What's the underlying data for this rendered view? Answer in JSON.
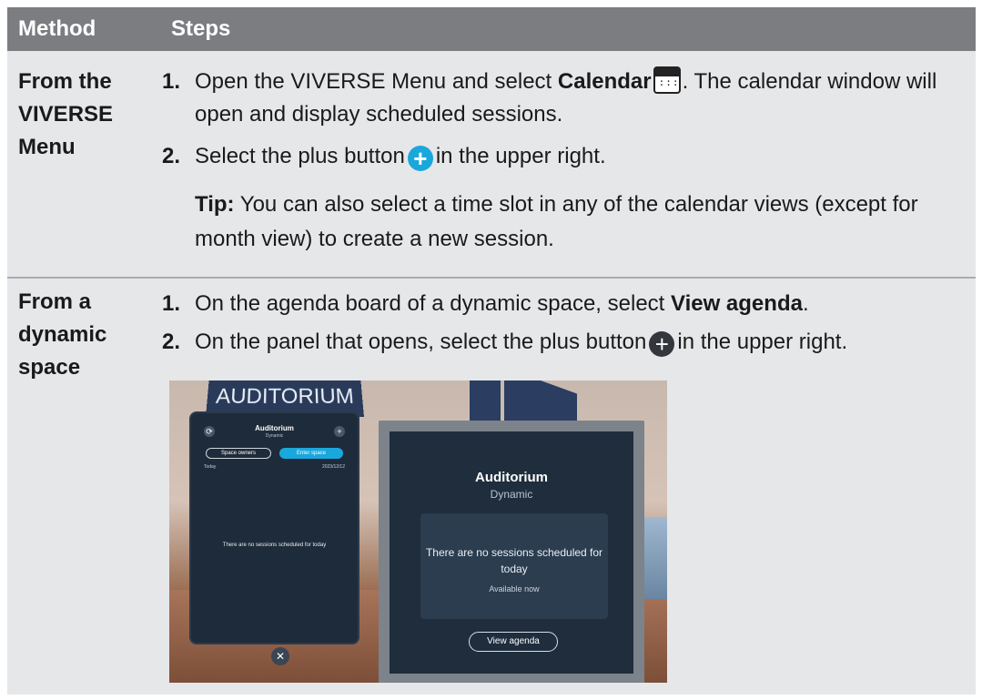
{
  "header": {
    "method": "Method",
    "steps": "Steps"
  },
  "rows": [
    {
      "method": "From the VIVERSE Menu",
      "steps": [
        {
          "num": "1.",
          "pre": "Open the VIVERSE Menu and select ",
          "bold": "Calendar",
          "post": ". The calendar window will open and display scheduled sessions."
        },
        {
          "num": "2.",
          "pre": "Select the plus button",
          "post": "in the upper right."
        }
      ],
      "tip": {
        "label": "Tip:",
        "text": " You can also select a time slot in any of the calendar views (except for month view) to create a new session."
      }
    },
    {
      "method": "From a dynamic space",
      "steps": [
        {
          "num": "1.",
          "pre": "On the agenda board of a dynamic space, select ",
          "bold": "View agenda",
          "post": "."
        },
        {
          "num": "2.",
          "pre": "On the panel that opens, select the plus button",
          "post": "in the upper right."
        }
      ]
    }
  ],
  "icons": {
    "calendar": "calendar-icon",
    "plus_blue": "plus-icon",
    "plus_dark": "plus-icon"
  },
  "colors": {
    "header_bg": "#7b7d81",
    "row_bg": "#e6e7e9",
    "accent": "#1aa7dc"
  },
  "screenshot": {
    "banner": "AUDITORIUM",
    "left_panel": {
      "title": "Auditorium",
      "subtitle": "Dynamic",
      "space_owners": "Space owners",
      "enter_space": "Enter space",
      "today": "Today",
      "date": "2023/12/12",
      "empty": "There are no sessions scheduled for today"
    },
    "right_panel": {
      "title": "Auditorium",
      "subtitle": "Dynamic",
      "message": "There are no sessions scheduled for today",
      "availability": "Available now",
      "button": "View agenda"
    }
  }
}
